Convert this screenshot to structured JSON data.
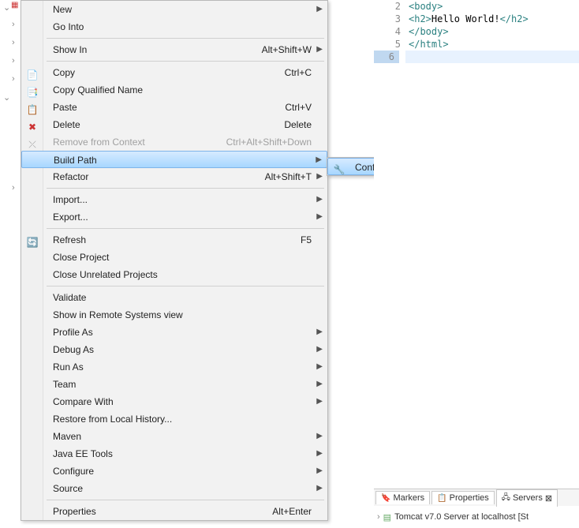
{
  "menu": {
    "items": [
      {
        "label": "New",
        "shortcut": "",
        "arrow": true
      },
      {
        "label": "Go Into",
        "shortcut": "",
        "arrow": false
      },
      {
        "sep": true
      },
      {
        "label": "Show In",
        "shortcut": "Alt+Shift+W",
        "arrow": true
      },
      {
        "sep": true
      },
      {
        "label": "Copy",
        "shortcut": "Ctrl+C",
        "icon": "copy"
      },
      {
        "label": "Copy Qualified Name",
        "icon": "copy-q"
      },
      {
        "label": "Paste",
        "shortcut": "Ctrl+V",
        "icon": "paste"
      },
      {
        "label": "Delete",
        "shortcut": "Delete",
        "icon": "delete"
      },
      {
        "label": "Remove from Context",
        "shortcut": "Ctrl+Alt+Shift+Down",
        "disabled": true,
        "icon": "remove-ctx"
      },
      {
        "label": "Build Path",
        "arrow": true,
        "selected": true
      },
      {
        "label": "Refactor",
        "shortcut": "Alt+Shift+T",
        "arrow": true
      },
      {
        "sep": true
      },
      {
        "label": "Import...",
        "arrow": true
      },
      {
        "label": "Export...",
        "arrow": true
      },
      {
        "sep": true
      },
      {
        "label": "Refresh",
        "shortcut": "F5",
        "icon": "refresh"
      },
      {
        "label": "Close Project"
      },
      {
        "label": "Close Unrelated Projects"
      },
      {
        "sep": true
      },
      {
        "label": "Validate"
      },
      {
        "label": "Show in Remote Systems view"
      },
      {
        "label": "Profile As",
        "arrow": true
      },
      {
        "label": "Debug As",
        "arrow": true
      },
      {
        "label": "Run As",
        "arrow": true
      },
      {
        "label": "Team",
        "arrow": true
      },
      {
        "label": "Compare With",
        "arrow": true
      },
      {
        "label": "Restore from Local History..."
      },
      {
        "label": "Maven",
        "arrow": true
      },
      {
        "label": "Java EE Tools",
        "arrow": true
      },
      {
        "label": "Configure",
        "arrow": true
      },
      {
        "label": "Source",
        "arrow": true
      },
      {
        "sep": true
      },
      {
        "label": "Properties",
        "shortcut": "Alt+Enter"
      }
    ]
  },
  "submenu": {
    "items": [
      {
        "label": "Configure Build Path...",
        "selected": true,
        "icon": "build-path"
      }
    ]
  },
  "editor": {
    "lines": [
      {
        "n": 2,
        "parts": [
          {
            "t": "<body>",
            "c": "tag"
          }
        ]
      },
      {
        "n": 3,
        "parts": [
          {
            "t": "<h2>",
            "c": "tag"
          },
          {
            "t": "Hello World!",
            "c": "txt"
          },
          {
            "t": "</h2>",
            "c": "tag"
          }
        ]
      },
      {
        "n": 4,
        "parts": [
          {
            "t": "</body>",
            "c": "tag"
          }
        ]
      },
      {
        "n": 5,
        "parts": [
          {
            "t": "</html>",
            "c": "tag"
          }
        ]
      },
      {
        "n": 6,
        "parts": []
      }
    ]
  },
  "bottom": {
    "tabs": [
      {
        "label": "Markers",
        "icon": "🔖"
      },
      {
        "label": "Properties",
        "icon": "📋"
      },
      {
        "label": "Servers",
        "icon": "🖧",
        "active": true,
        "close": "⊠"
      }
    ],
    "server": "Tomcat v7.0 Server at localhost  [St"
  },
  "icons": {
    "copy": "📄",
    "copy-q": "📑",
    "paste": "📋",
    "delete": "✖",
    "remove-ctx": "⤫",
    "refresh": "🔄",
    "build-path": "🔧"
  }
}
